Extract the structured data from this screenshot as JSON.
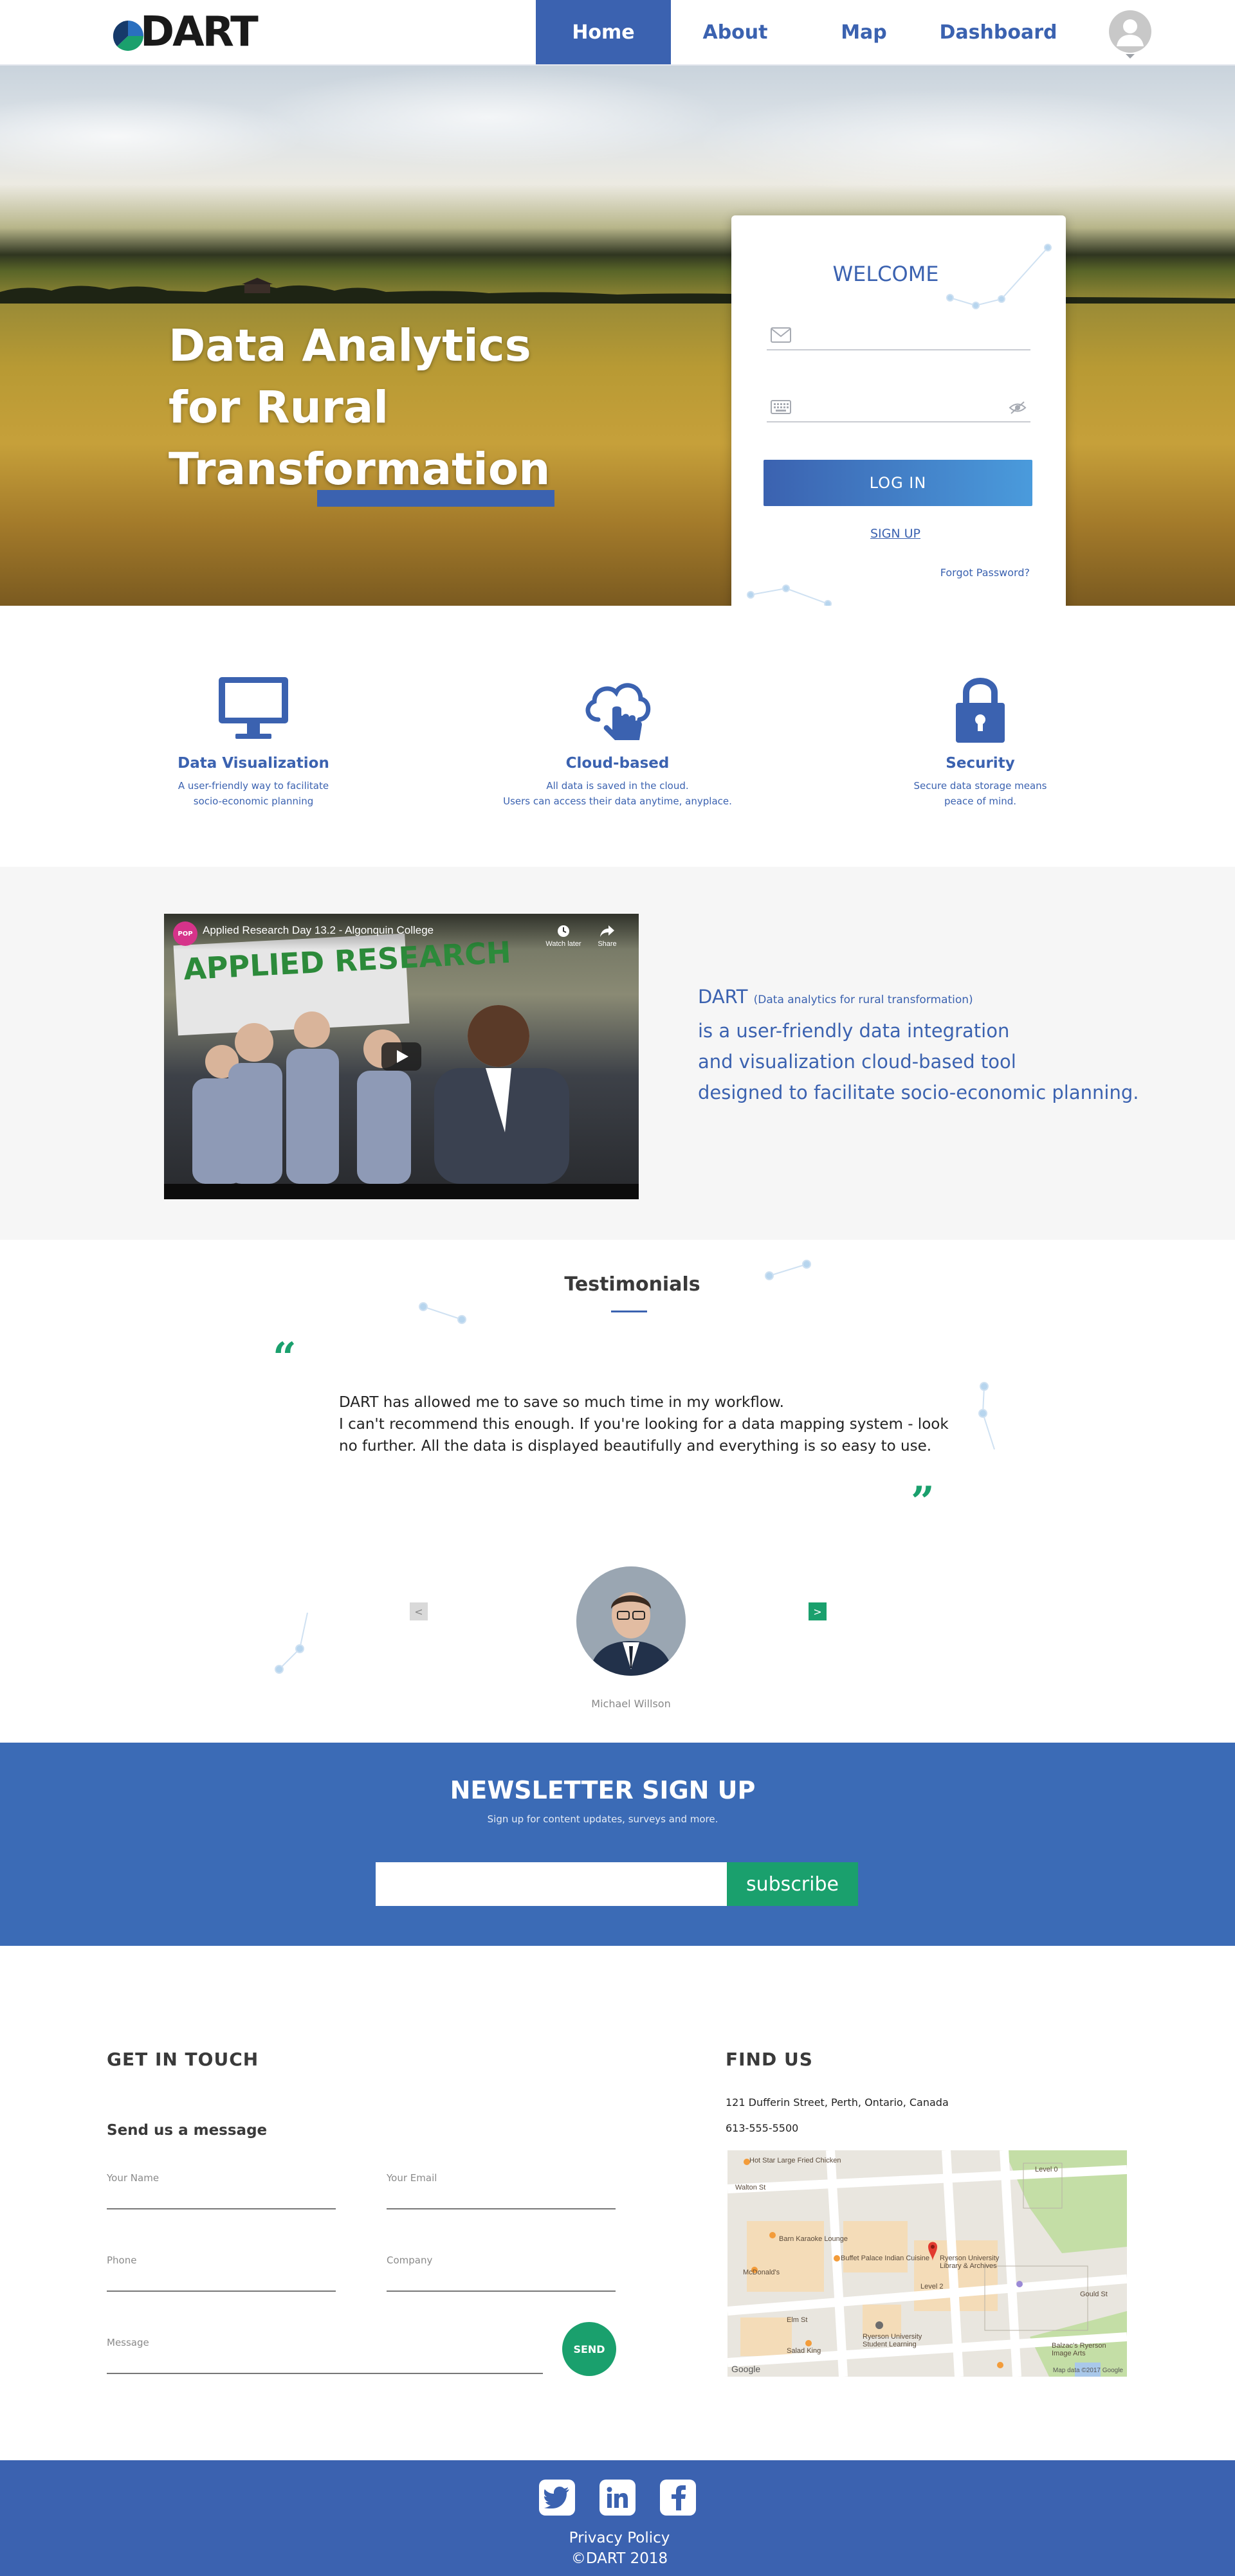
{
  "brand": {
    "logo_text": "DART"
  },
  "nav": {
    "items": [
      {
        "label": "Home",
        "active": true
      },
      {
        "label": "About",
        "active": false
      },
      {
        "label": "Map",
        "active": false
      },
      {
        "label": "Dashboard",
        "active": false
      }
    ],
    "avatar_icon": "user-avatar-icon"
  },
  "hero": {
    "title_lines": [
      "Data Analytics",
      "for Rural",
      "Transformation"
    ]
  },
  "login": {
    "welcome": "WELCOME",
    "email_icon": "mail-icon",
    "password_icon": "keyboard-icon",
    "eye_icon": "eye-hidden-icon",
    "email_value": "",
    "password_value": "",
    "login_label": "LOG IN",
    "signup_label": "SIGN UP",
    "forgot_label": "Forgot Password?"
  },
  "features": [
    {
      "icon": "monitor-icon",
      "title": "Data Visualization",
      "desc_lines": [
        "A user-friendly way to facilitate",
        "socio-economic planning"
      ]
    },
    {
      "icon": "cloud-touch-icon",
      "title": "Cloud-based",
      "desc_lines": [
        "All data is saved in the cloud.",
        "Users can access their data anytime, anyplace."
      ]
    },
    {
      "icon": "lock-icon",
      "title": "Security",
      "desc_lines": [
        "Secure data storage means",
        "peace of mind."
      ]
    }
  ],
  "video": {
    "channel_badge": "POP",
    "title": "Applied Research Day 13.2 - Algonquin College",
    "banner_text": "APPLIED RESEARCH",
    "watch_later": "Watch later",
    "share": "Share"
  },
  "about": {
    "name": "DART",
    "name_expanded": "(Data analytics for rural transformation)",
    "lines": [
      "is a user-friendly data integration",
      "and visualization cloud-based tool",
      "designed to facilitate socio-economic planning."
    ]
  },
  "testimonials": {
    "title": "Testimonials",
    "open_quote": "“",
    "close_quote": "”",
    "lines": [
      "DART has allowed me to save so much time in my workflow.",
      "I can't recommend this enough. If you're looking for a data mapping system - look",
      "no further. All the data is displayed beautifully and everything is so easy to use."
    ],
    "prev": "<",
    "next": ">",
    "author": "Michael Willson"
  },
  "newsletter": {
    "title": "NEWSLETTER SIGN UP",
    "subtitle": "Sign up for content updates, surveys and more.",
    "email_value": "",
    "button": "subscribe"
  },
  "contact": {
    "heading": "GET IN TOUCH",
    "subheading": "Send us a message",
    "fields": {
      "name": "Your Name",
      "email": "Your Email",
      "phone": "Phone",
      "company": "Company",
      "message": "Message"
    },
    "send": "SEND"
  },
  "find_us": {
    "heading": "FIND US",
    "address": "121 Dufferin Street, Perth, Ontario, Canada",
    "phone": "613-555-5500",
    "map_labels": [
      "Hot Star Large Fried Chicken",
      "Walton St",
      "Barn Karaoke Lounge",
      "McDonald's",
      "Buffet Palace Indian Cuisine",
      "Ryerson University Library & Archives",
      "Level 2",
      "Level 0",
      "Ryerson University Student Learning",
      "Salad King",
      "Balzac's Ryerson Image Arts",
      "Elm St",
      "Gould St"
    ],
    "google": "Google",
    "map_data": "Map data ©2017 Google"
  },
  "footer": {
    "social": [
      "twitter-icon",
      "linkedin-icon",
      "facebook-icon"
    ],
    "privacy": "Privacy Policy",
    "copyright": "©DART 2018"
  },
  "colors": {
    "brand_blue": "#3b62b0",
    "accent_green": "#1aa06d",
    "newsletter_blue": "#3b6bb6"
  }
}
